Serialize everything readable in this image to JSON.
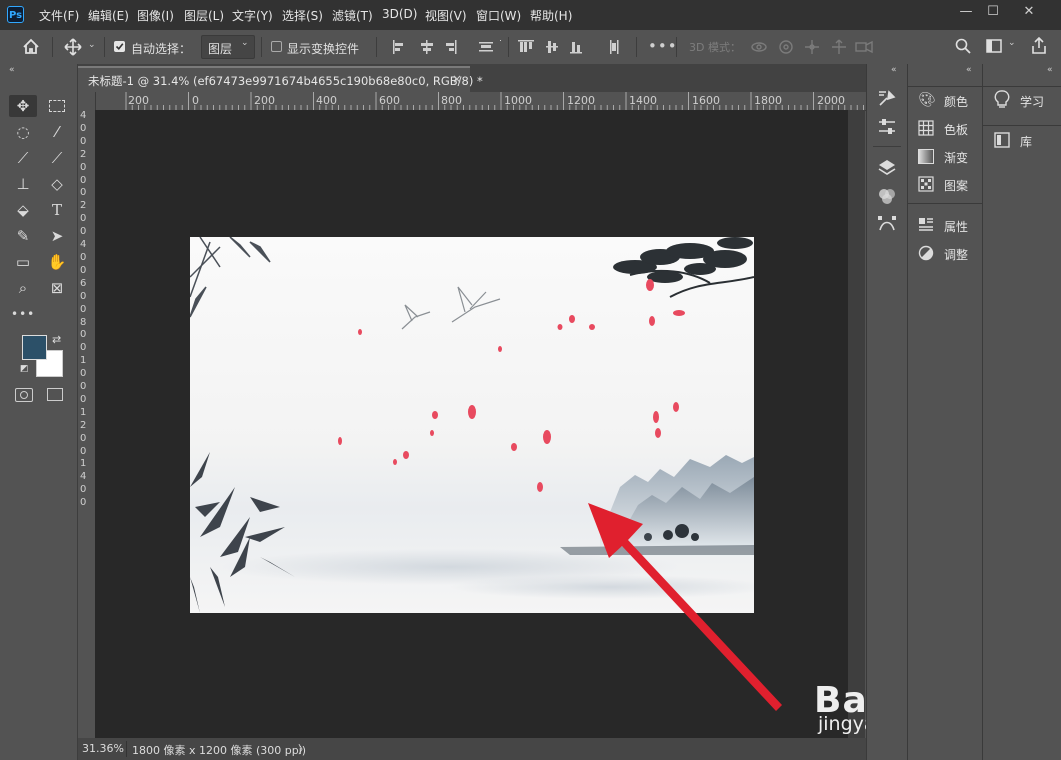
{
  "app": {
    "logo": "Ps"
  },
  "menu": [
    "文件(F)",
    "编辑(E)",
    "图像(I)",
    "图层(L)",
    "文字(Y)",
    "选择(S)",
    "滤镜(T)",
    "3D(D)",
    "视图(V)",
    "窗口(W)",
    "帮助(H)"
  ],
  "window_controls": {
    "minimize": "—",
    "maximize": "☐",
    "close": "✕"
  },
  "options_bar": {
    "auto_select_label": "自动选择：",
    "auto_select_checked": true,
    "auto_select_target": "图层",
    "transform_controls_label": "显示变换控件",
    "transform_controls_checked": false,
    "mode_3d_label": "3D 模式："
  },
  "document": {
    "tab_title": "未标题-1 @ 31.4% (ef67473e9971674b4655c190b68e80c0, RGB/8) *",
    "tab_close": "×"
  },
  "ruler_top_labels": [
    "200",
    "0",
    "200",
    "400",
    "600",
    "800",
    "1000",
    "1200",
    "1400",
    "1600",
    "1800",
    "2000"
  ],
  "ruler_left_labels": [
    "4",
    "0",
    "0",
    "2",
    "0",
    "0",
    "0",
    "2",
    "0",
    "0",
    "4",
    "0",
    "0",
    "6",
    "0",
    "0",
    "8",
    "0",
    "0",
    "1",
    "0",
    "0",
    "0",
    "1",
    "2",
    "0",
    "0",
    "1",
    "4",
    "0",
    "0"
  ],
  "status": {
    "zoom": "31.36%",
    "doc_info": "1800 像素 x 1200 像素 (300 ppi)",
    "arrow": "〉"
  },
  "colors": {
    "foreground": "#2c5068",
    "background": "#ffffff",
    "accent_arrow": "#e0202e"
  },
  "panels": {
    "left_group": [
      {
        "label": "颜色",
        "icon": "palette-icon"
      },
      {
        "label": "色板",
        "icon": "swatches-icon"
      },
      {
        "label": "渐变",
        "icon": "gradient-icon"
      },
      {
        "label": "图案",
        "icon": "pattern-icon"
      },
      {
        "label": "属性",
        "icon": "properties-icon"
      },
      {
        "label": "调整",
        "icon": "adjustments-icon"
      }
    ],
    "right_group": [
      {
        "label": "学习",
        "icon": "lightbulb-icon"
      },
      {
        "label": "库",
        "icon": "library-icon"
      }
    ]
  },
  "watermark": {
    "brand": "Bai du 经验",
    "url": "jingyan.baidu.com"
  }
}
